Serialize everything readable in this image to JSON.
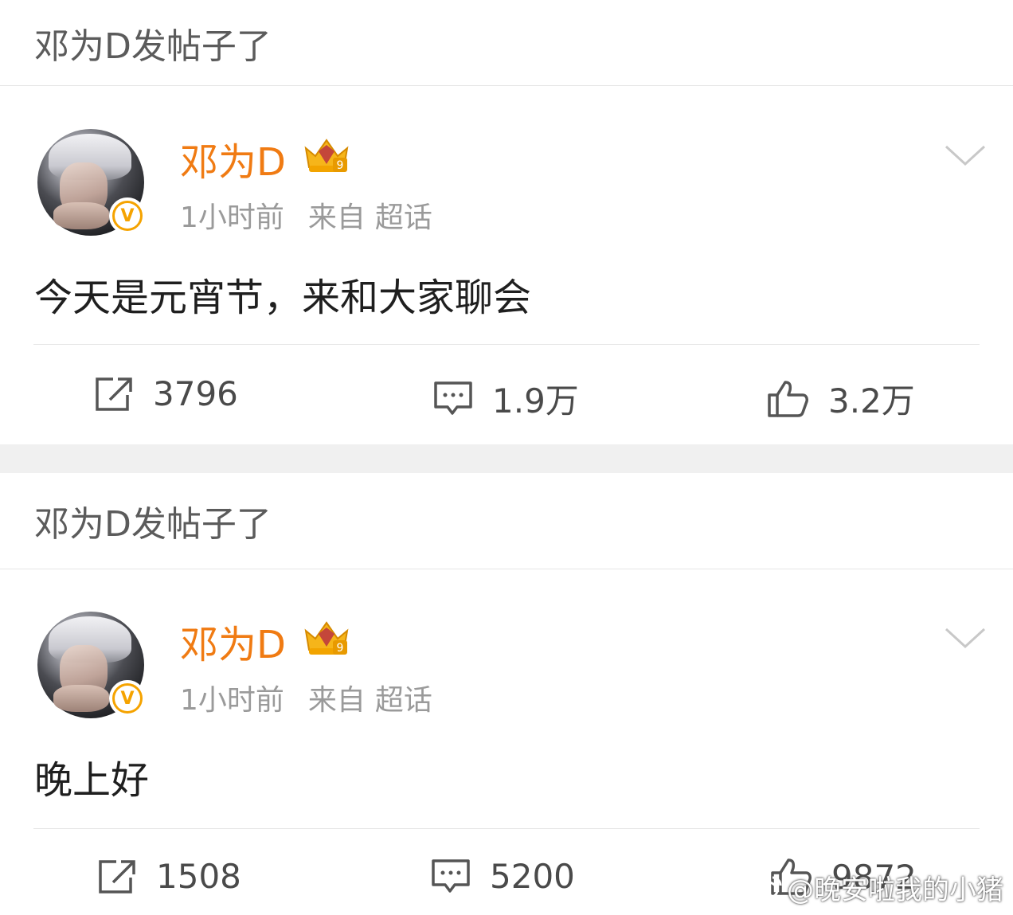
{
  "posts": [
    {
      "section_title": "邓为D发帖子了",
      "username": "邓为D",
      "crown_level": "9",
      "verified_badge": "V",
      "time": "1小时前",
      "source_label": "来自",
      "source": "超话",
      "content": "今天是元宵节，来和大家聊会",
      "reposts": "3796",
      "comments": "1.9万",
      "likes": "3.2万"
    },
    {
      "section_title": "邓为D发帖子了",
      "username": "邓为D",
      "crown_level": "9",
      "verified_badge": "V",
      "time": "1小时前",
      "source_label": "来自",
      "source": "超话",
      "content": "晚上好",
      "reposts": "1508",
      "comments": "5200",
      "likes": "9872"
    }
  ],
  "watermark": "@晚安啦我的小猪",
  "colors": {
    "username": "#f07b13",
    "meta": "#9a9a9a",
    "badge": "#f5a300",
    "separator": "#f0f0f0"
  },
  "icons": [
    "repost-icon",
    "comment-icon",
    "like-icon",
    "chevron-down-icon",
    "crown-icon",
    "verified-icon",
    "weibo-logo-icon"
  ]
}
